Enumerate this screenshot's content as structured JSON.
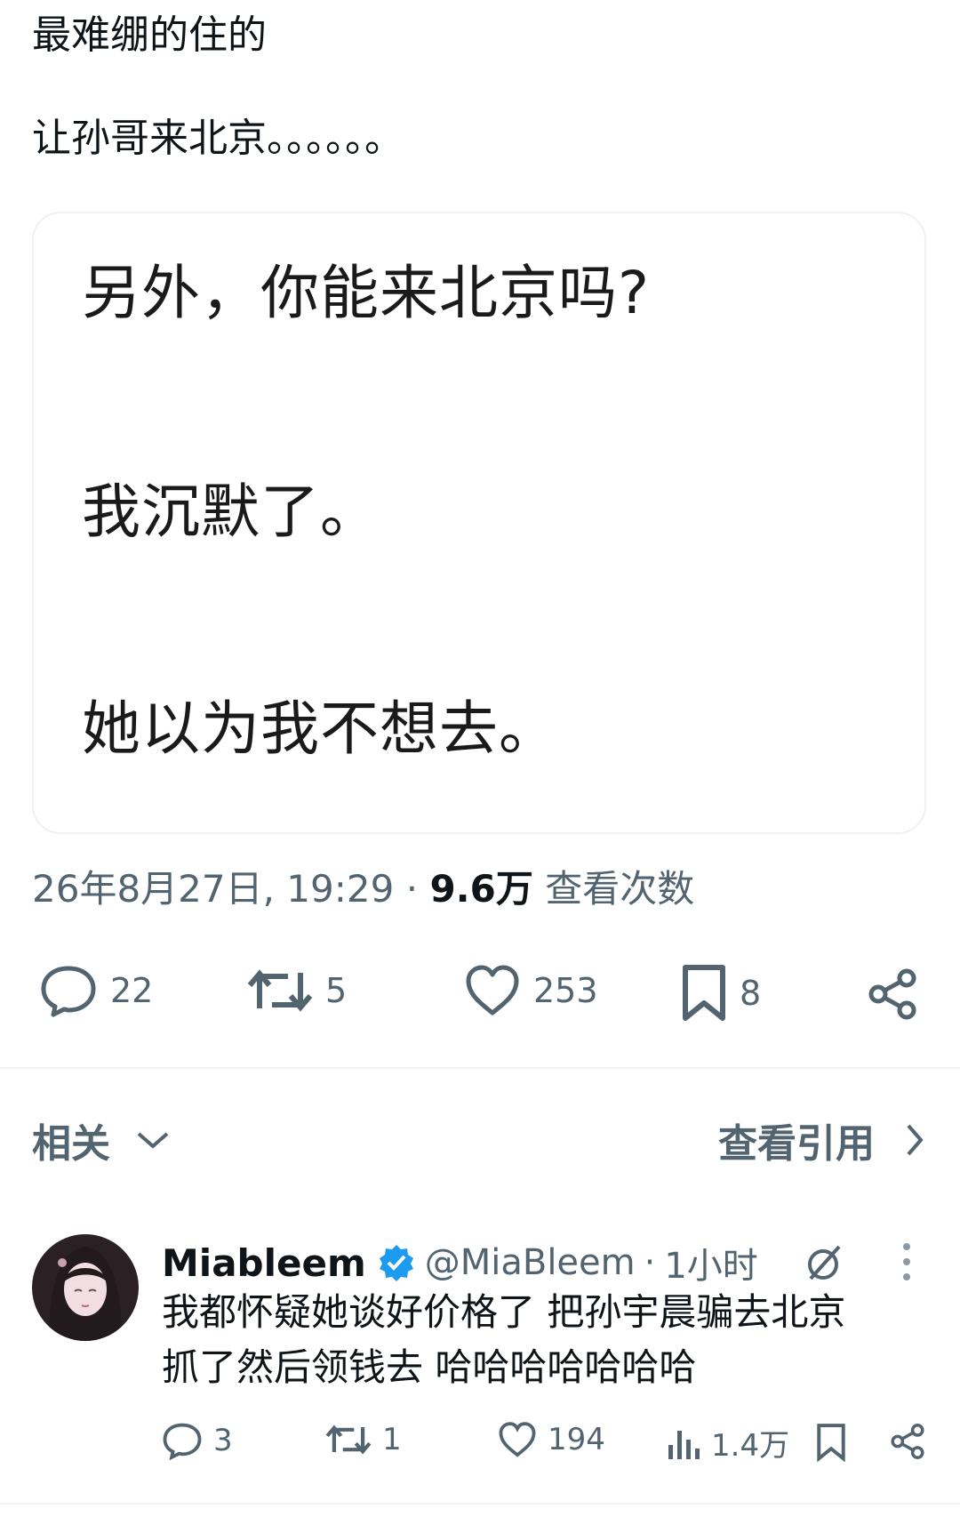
{
  "post": {
    "line1": "最难绷的住的",
    "line2": "让孙哥来北京。。。。。。"
  },
  "quote": {
    "lines": [
      "另外，你能来北京吗?",
      "我沉默了。",
      "她以为我不想去。"
    ]
  },
  "meta": {
    "timestamp": "26年8月27日, 19:29",
    "separator": "·",
    "views": "9.6万",
    "views_label": "查看次数"
  },
  "actions": {
    "replies": "22",
    "retweets": "5",
    "likes": "253",
    "bookmarks": "8"
  },
  "related": {
    "label": "相关",
    "view_quotes": "查看引用"
  },
  "reply": {
    "name": "Miableem",
    "handle": "@MiaBleem",
    "dot": "·",
    "time": "1小时",
    "text_line1": "我都怀疑她谈好价格了 把孙宇晨骗去北京",
    "text_line2": "抓了然后领钱去 哈哈哈哈哈哈哈",
    "replies": "3",
    "retweets": "1",
    "likes": "194",
    "views": "1.4万"
  },
  "colors": {
    "text": "#0f1419",
    "secondary": "#536471",
    "verified": "#1d9bf0",
    "border": "#eef0f3"
  }
}
